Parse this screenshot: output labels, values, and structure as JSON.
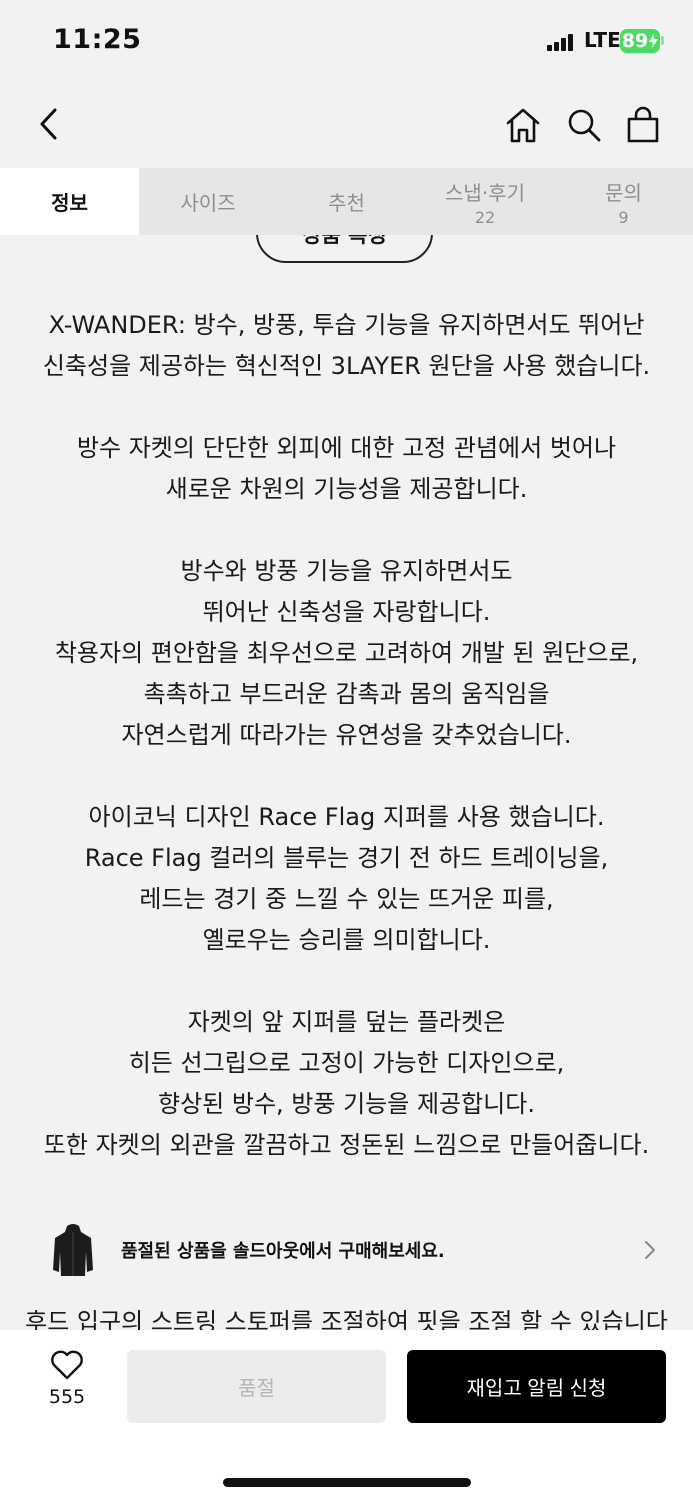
{
  "status_bar": {
    "time": "11:25",
    "network": "LTE",
    "battery": "89"
  },
  "nav": {
    "icons": [
      "chevron-left-icon",
      "home-icon",
      "search-icon",
      "shopping-bag-icon"
    ]
  },
  "tabs": [
    {
      "label": "정보",
      "count": "",
      "active": true
    },
    {
      "label": "사이즈",
      "count": ""
    },
    {
      "label": "추천",
      "count": ""
    },
    {
      "label": "스냅·후기",
      "count": "22"
    },
    {
      "label": "문의",
      "count": "9"
    }
  ],
  "section_title": "상품 특징",
  "description": {
    "p1": [
      "X-WANDER: 방수, 방풍, 투습 기능을 유지하면서도 뛰어난",
      "신축성을 제공하는 혁신적인 3LAYER 원단을 사용 했습니다."
    ],
    "p2": [
      "방수 자켓의 단단한 외피에 대한 고정 관념에서 벗어나",
      "새로운 차원의 기능성을 제공합니다."
    ],
    "p3": [
      "방수와 방풍 기능을 유지하면서도",
      "뛰어난 신축성을 자랑합니다.",
      "착용자의 편안함을 최우선으로 고려하여 개발 된 원단으로,",
      "촉촉하고 부드러운 감촉과 몸의 움직임을",
      "자연스럽게 따라가는 유연성을 갖추었습니다."
    ],
    "p4": [
      "아이코닉 디자인 Race Flag 지퍼를 사용 했습니다.",
      "Race Flag 컬러의 블루는 경기 전 하드 트레이닝을,",
      "레드는 경기 중 느낄 수 있는 뜨거운 피를,",
      "옐로우는 승리를 의미합니다."
    ],
    "p5": [
      "자켓의 앞 지퍼를 덮는 플라켓은",
      "히든 선그립으로 고정이 가능한 디자인으로,",
      "향상된 방수, 방풍 기능을 제공합니다.",
      "또한 자켓의 외관을 깔끔하고 정돈된 느낌으로 만들어줍니다."
    ],
    "cut_line": "후드 입구의 스트링 스토퍼를 조절하여 핏을 조절 할 수 있습니다"
  },
  "soldout_banner": {
    "text": "품절된 상품을 솔드아웃에서 구매해보세요."
  },
  "bottom_bar": {
    "like_count": "555",
    "soldout_label": "품절",
    "notify_label": "재입고 알림 신청"
  },
  "colors": {
    "accent": "#000000",
    "battery": "#4cd964",
    "tab_bg": "#e6e6e6",
    "page_bg": "#f2f2f2"
  }
}
